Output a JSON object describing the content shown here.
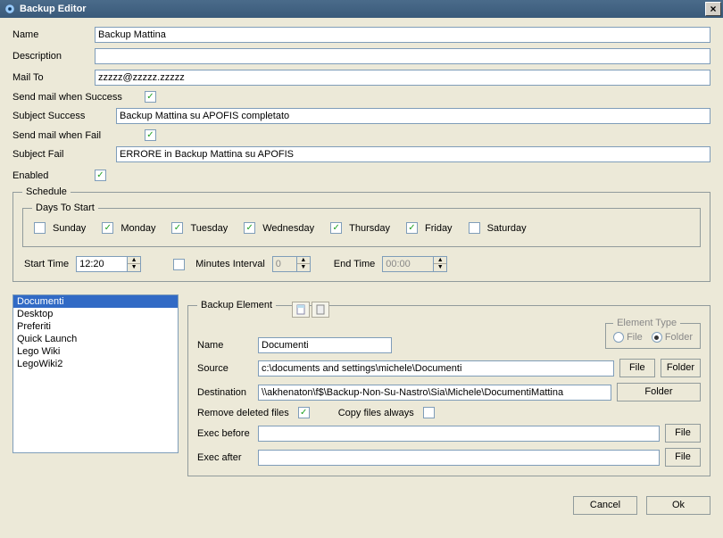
{
  "window": {
    "title": "Backup Editor"
  },
  "labels": {
    "name": "Name",
    "description": "Description",
    "mail_to": "Mail To",
    "send_success": "Send mail when Success",
    "subject_success": "Subject Success",
    "send_fail": "Send mail when Fail",
    "subject_fail": "Subject Fail",
    "enabled": "Enabled"
  },
  "fields": {
    "name": "Backup Mattina",
    "description": "",
    "mail_to": "zzzzz@zzzzz.zzzzz",
    "subject_success": "Backup Mattina su APOFIS completato",
    "subject_fail": "ERRORE in Backup Mattina su APOFIS"
  },
  "checks": {
    "send_success": true,
    "send_fail": true,
    "enabled": true
  },
  "schedule": {
    "legend": "Schedule",
    "days_legend": "Days To Start",
    "days": [
      {
        "label": "Sunday",
        "checked": false
      },
      {
        "label": "Monday",
        "checked": true
      },
      {
        "label": "Tuesday",
        "checked": true
      },
      {
        "label": "Wednesday",
        "checked": true
      },
      {
        "label": "Thursday",
        "checked": true
      },
      {
        "label": "Friday",
        "checked": true
      },
      {
        "label": "Saturday",
        "checked": false
      }
    ],
    "start_time_label": "Start Time",
    "start_time": "12:20",
    "minutes_interval_label": "Minutes Interval",
    "minutes_interval": "0",
    "minutes_interval_enabled": false,
    "end_time_label": "End Time",
    "end_time": "00:00"
  },
  "list": {
    "items": [
      "Documenti",
      "Desktop",
      "Preferiti",
      "Quick Launch",
      "Lego Wiki",
      "LegoWiki2"
    ],
    "selected_index": 0
  },
  "element": {
    "legend": "Backup Element",
    "name_label": "Name",
    "name": "Documenti",
    "source_label": "Source",
    "source": "c:\\documents and settings\\michele\\Documenti",
    "source_file_btn": "File",
    "source_folder_btn": "Folder",
    "dest_label": "Destination",
    "dest": "\\\\akhenaton\\f$\\Backup-Non-Su-Nastro\\Sia\\Michele\\DocumentiMattina",
    "dest_folder_btn": "Folder",
    "remove_deleted_label": "Remove deleted files",
    "remove_deleted": true,
    "copy_always_label": "Copy files always",
    "copy_always": false,
    "exec_before_label": "Exec before",
    "exec_before": "",
    "exec_before_btn": "File",
    "exec_after_label": "Exec after",
    "exec_after": "",
    "exec_after_btn": "File",
    "type_legend": "Element Type",
    "type_file": "File",
    "type_folder": "Folder",
    "type_selected": "folder"
  },
  "footer": {
    "cancel": "Cancel",
    "ok": "Ok"
  }
}
